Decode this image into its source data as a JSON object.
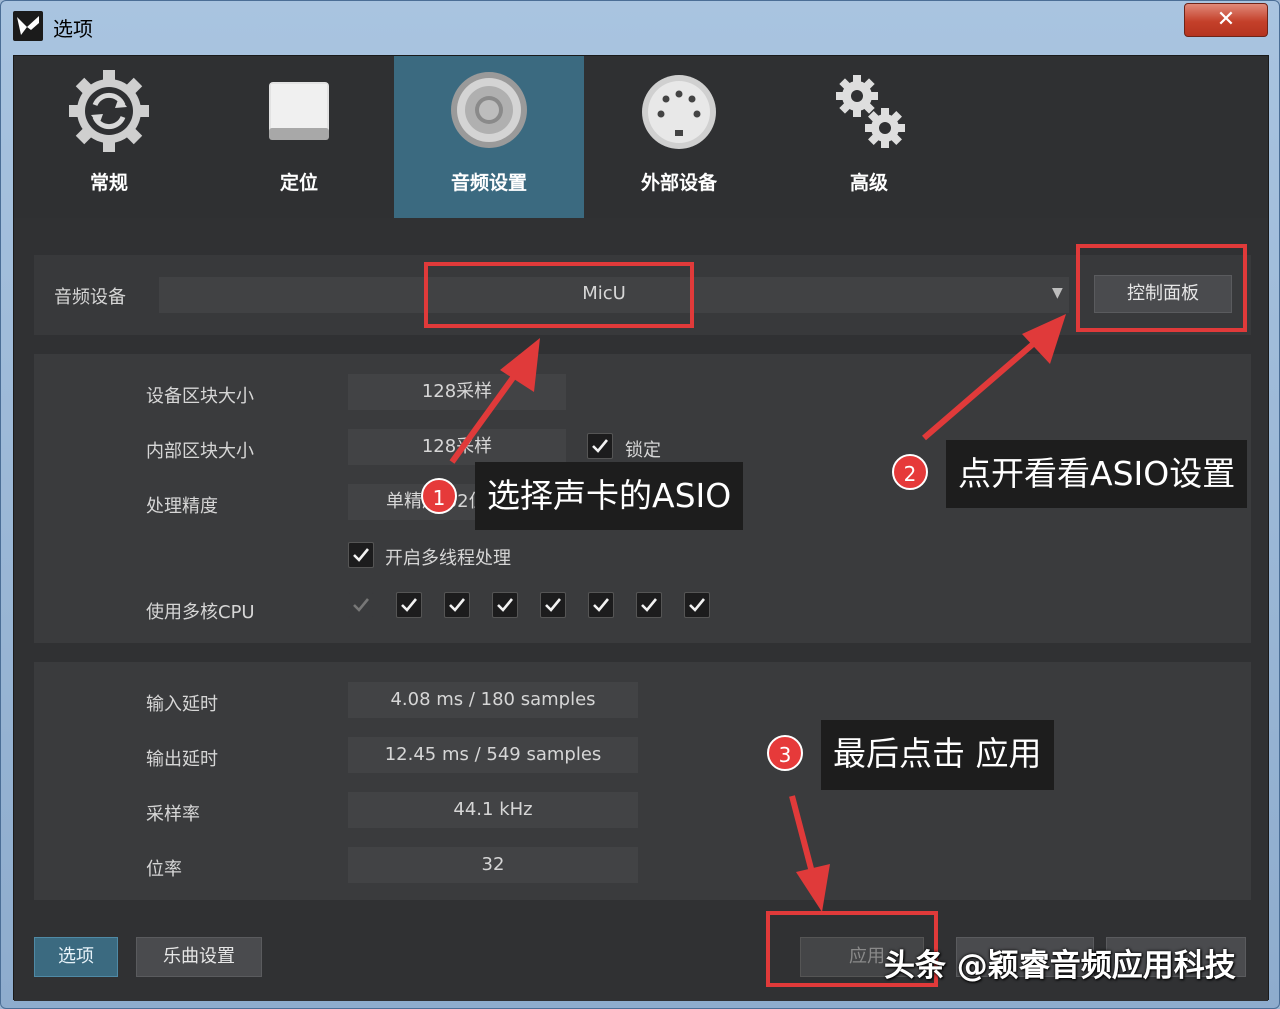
{
  "window": {
    "title": "选项",
    "close_glyph": "✕"
  },
  "tabs": [
    {
      "label": "常规",
      "icon": "refresh-gear-icon",
      "active": false
    },
    {
      "label": "定位",
      "icon": "drive-icon",
      "active": false
    },
    {
      "label": "音频设置",
      "icon": "speaker-icon",
      "active": true
    },
    {
      "label": "外部设备",
      "icon": "midi-connector-icon",
      "active": false
    },
    {
      "label": "高级",
      "icon": "gears-icon",
      "active": false
    }
  ],
  "audio_device": {
    "label": "音频设备",
    "value": "MicU",
    "control_panel_label": "控制面板"
  },
  "settings": {
    "device_block_size": {
      "label": "设备区块大小",
      "value": "128采样"
    },
    "internal_block_size": {
      "label": "内部区块大小",
      "value": "128采样",
      "lock_label": "锁定",
      "lock_checked": true
    },
    "precision": {
      "label": "处理精度",
      "value": "单精度 32位"
    },
    "multithread": {
      "label": "开启多线程处理",
      "checked": true
    },
    "multicore": {
      "label": "使用多核CPU",
      "cores_checked": [
        false,
        true,
        true,
        true,
        true,
        true,
        true,
        true
      ]
    }
  },
  "latency": {
    "input": {
      "label": "输入延时",
      "value": "4.08 ms / 180 samples"
    },
    "output": {
      "label": "输出延时",
      "value": "12.45 ms / 549 samples"
    },
    "sample_rate": {
      "label": "采样率",
      "value": "44.1 kHz"
    },
    "bit_depth": {
      "label": "位率",
      "value": "32"
    }
  },
  "footer": {
    "options_label": "选项",
    "song_settings_label": "乐曲设置",
    "apply_label": "应用"
  },
  "annotations": {
    "callout1": {
      "number": "1",
      "text": "选择声卡的ASIO"
    },
    "callout2": {
      "number": "2",
      "text": "点开看看ASIO设置"
    },
    "callout3": {
      "number": "3",
      "text": "最后点击 应用"
    },
    "watermark": "头条 @颖睿音频应用科技",
    "highlight_color": "#e03a3a"
  },
  "colors": {
    "active_tab": "#3b6a80",
    "panel_bg": "#3a3b3d",
    "text": "#d6d6d6"
  }
}
